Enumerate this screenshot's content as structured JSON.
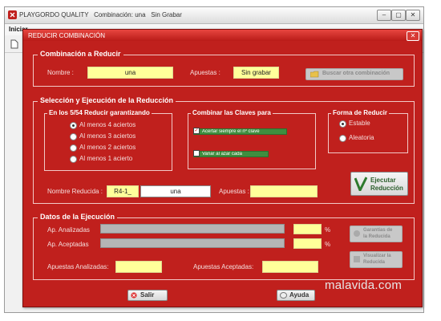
{
  "app": {
    "title": "PLAYGORDO QUALITY   Combinación: una   Sin Grabar",
    "menu_first": "Iniciar",
    "min_glyph": "–",
    "max_glyph": "▢",
    "close_glyph": "✕"
  },
  "dialog": {
    "title": "REDUCIR COMBINACIÓN",
    "close_glyph": "✕",
    "combo_section": {
      "title": "Combinación a Reducir",
      "nombre_label": "Nombre :",
      "nombre_value": "una",
      "apuestas_label": "Apuestas :",
      "apuestas_value": "Sin grabar",
      "buscar_label": "Buscar otra combinación"
    },
    "selection_section": {
      "title": "Selección y Ejecución de la Reducción",
      "guarantee_group": "En los 5/54 Reducir garantizando",
      "guarantee_options": [
        "Al menos 4 aciertos",
        "Al menos 3 aciertos",
        "Al menos 2 aciertos",
        "Al menos 1 acierto"
      ],
      "guarantee_selected": "Al menos 4 aciertos",
      "combinar_group": "Combinar las Claves para",
      "acertar_label": "Acertar siempre el nº clave",
      "acertar_checked": true,
      "variar_label": "Variar al azar cada",
      "variar_checked": false,
      "forma_group": "Forma de Reducir",
      "forma_options": [
        "Estable",
        "Aleatoria"
      ],
      "forma_selected": "Estable",
      "nombre_reducida_label": "Nombre Reducida :",
      "nombre_reducida_prefix": "R4-1_",
      "nombre_reducida_value": "una",
      "apuestas_label": "Apuestas :",
      "apuestas_value": "",
      "ejecutar_line1": "Ejecutar",
      "ejecutar_line2": "Reducción"
    },
    "datos_section": {
      "title": "Datos de la Ejecución",
      "analizadas_label": "Ap. Analizadas",
      "aceptadas_label": "Ap. Aceptadas",
      "percent_symbol": "%",
      "garantias_line1": "Garantías de",
      "garantias_line2": "la Reducida",
      "visualizar_line1": "Visualizar la",
      "visualizar_line2": "Reducida",
      "apuestas_analizadas_label": "Apuestas Analizadas:",
      "apuestas_aceptadas_label": "Apuestas Aceptadas:"
    },
    "salir_label": "Salir",
    "ayuda_label": "Ayuda"
  },
  "watermark": "malavida.com",
  "colors": {
    "dialog_bg": "#c0201d",
    "field_yellow": "#ffff9a",
    "accent_green": "#3f8e3f"
  }
}
